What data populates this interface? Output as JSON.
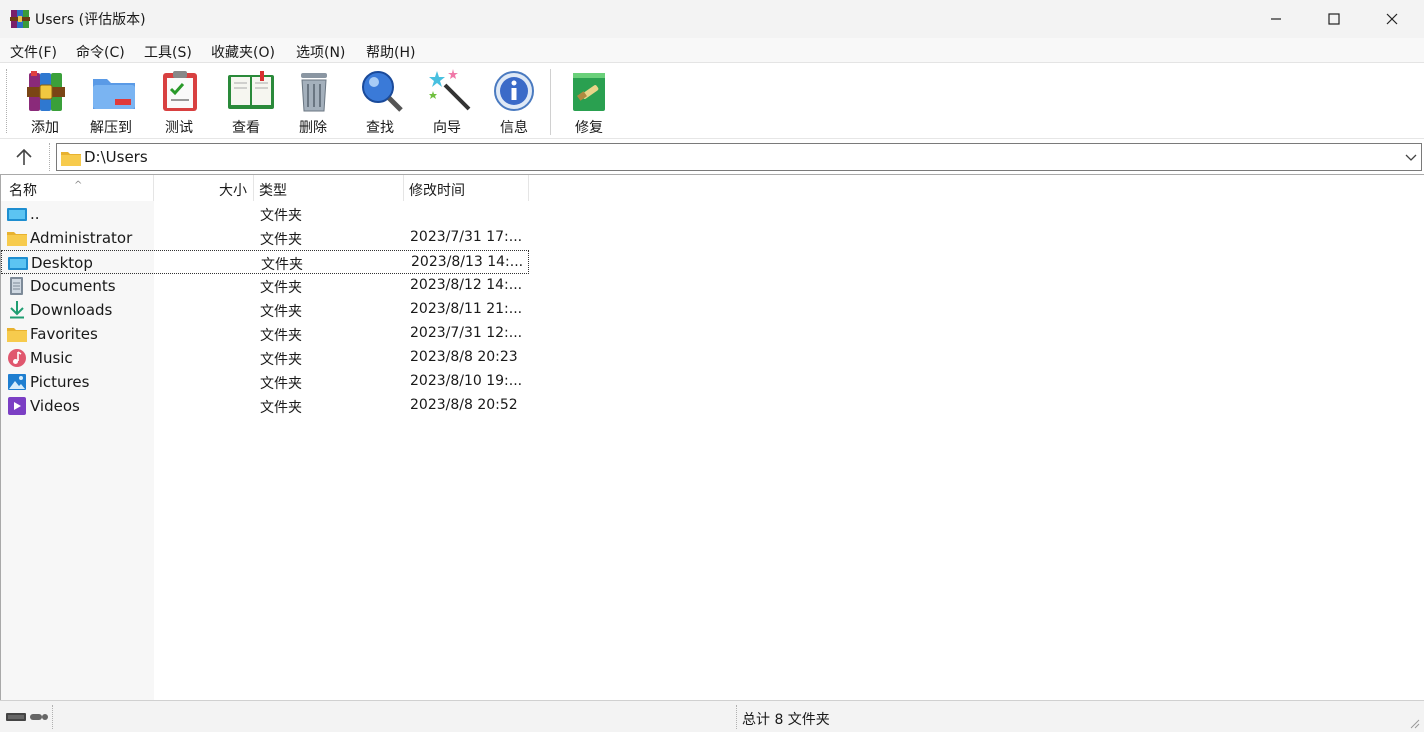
{
  "window": {
    "title": "Users (评估版本)"
  },
  "menu": [
    "文件(F)",
    "命令(C)",
    "工具(S)",
    "收藏夹(O)",
    "选项(N)",
    "帮助(H)"
  ],
  "toolbar": {
    "add": "添加",
    "extract": "解压到",
    "test": "测试",
    "view": "查看",
    "delete": "删除",
    "find": "查找",
    "wizard": "向导",
    "info": "信息",
    "repair": "修复"
  },
  "address": {
    "path": "D:\\Users"
  },
  "columns": {
    "name": "名称",
    "size": "大小",
    "type": "类型",
    "modified": "修改时间"
  },
  "rows": [
    {
      "name": "..",
      "type": "文件夹",
      "modified": "",
      "icon": "parent-folder-icon"
    },
    {
      "name": "Administrator",
      "type": "文件夹",
      "modified": "2023/7/31 17:...",
      "icon": "folder-icon"
    },
    {
      "name": "Desktop",
      "type": "文件夹",
      "modified": "2023/8/13 14:...",
      "icon": "desktop-icon",
      "selected": true
    },
    {
      "name": "Documents",
      "type": "文件夹",
      "modified": "2023/8/12 14:...",
      "icon": "documents-icon"
    },
    {
      "name": "Downloads",
      "type": "文件夹",
      "modified": "2023/8/11 21:...",
      "icon": "downloads-icon"
    },
    {
      "name": "Favorites",
      "type": "文件夹",
      "modified": "2023/7/31 12:...",
      "icon": "folder-icon"
    },
    {
      "name": "Music",
      "type": "文件夹",
      "modified": "2023/8/8 20:23",
      "icon": "music-icon"
    },
    {
      "name": "Pictures",
      "type": "文件夹",
      "modified": "2023/8/10 19:...",
      "icon": "pictures-icon"
    },
    {
      "name": "Videos",
      "type": "文件夹",
      "modified": "2023/8/8 20:52",
      "icon": "videos-icon"
    }
  ],
  "status": {
    "summary": "总计 8 文件夹"
  }
}
